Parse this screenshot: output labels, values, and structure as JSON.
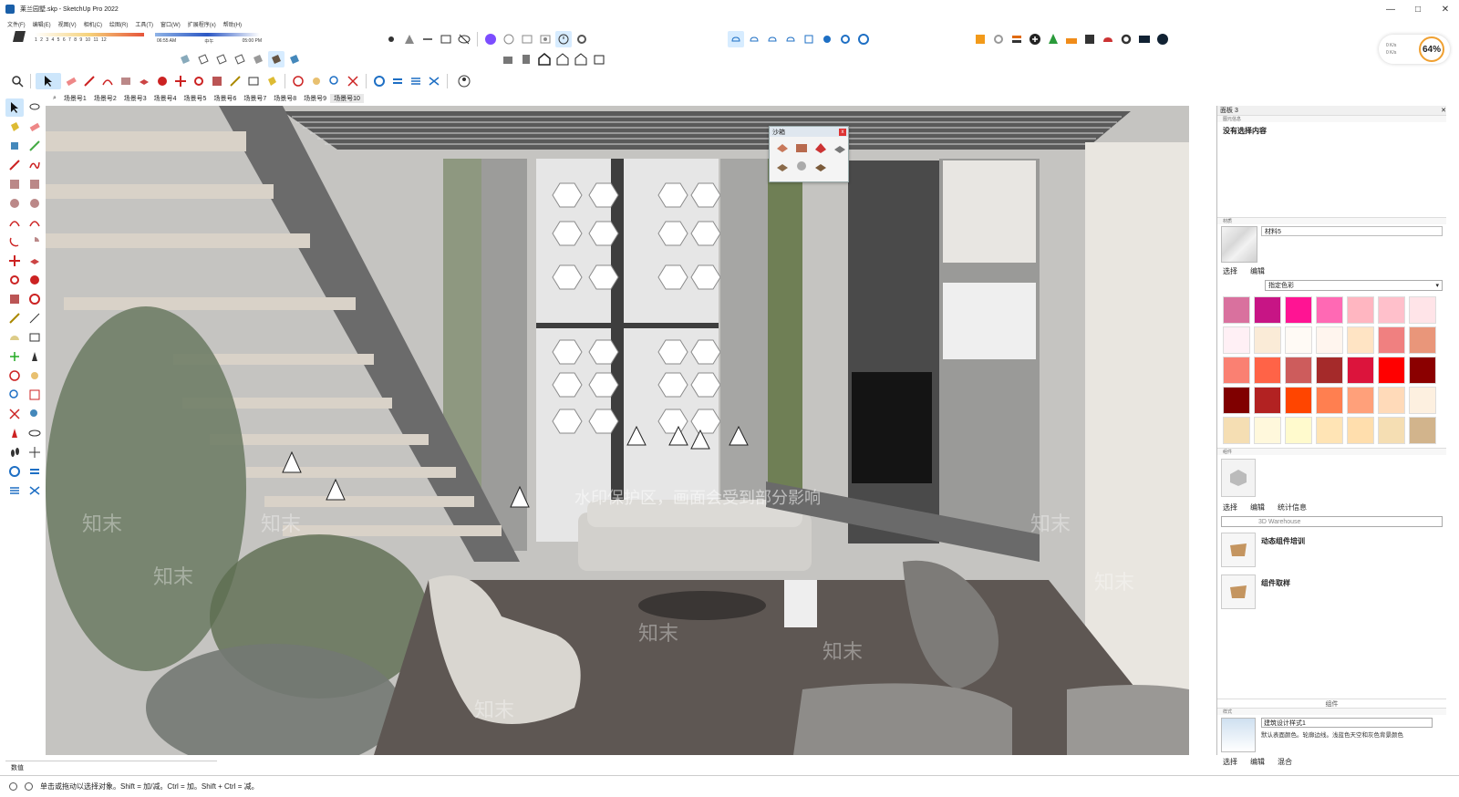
{
  "window": {
    "title": "莱兰园墅.skp - SketchUp Pro 2022",
    "minimize": "—",
    "maximize": "□",
    "close": "✕"
  },
  "menu": [
    "文件(F)",
    "编辑(E)",
    "视图(V)",
    "相机(C)",
    "绘图(R)",
    "工具(T)",
    "窗口(W)",
    "扩展程序(x)",
    "帮助(H)"
  ],
  "shadow": {
    "months": "1 2 3 4 5 6 7 8 9 10 11 12",
    "time_start": "06:55 AM",
    "time_mid": "中午",
    "time_end": "05:00 PM"
  },
  "scenes": [
    "场景号1",
    "场景号2",
    "场景号3",
    "场景号4",
    "场景号5",
    "场景号6",
    "场景号7",
    "场景号8",
    "场景号9",
    "场景号10"
  ],
  "active_scene_index": 9,
  "sandbox": {
    "title": "沙箱",
    "close": "x"
  },
  "watermark": {
    "text": "水印保护区，画面会受到部分影响",
    "brand": "知末"
  },
  "panel": {
    "title": "面板 3",
    "entity_info_header": "图元信息",
    "entity_info_text": "没有选择内容",
    "materials_header": "材质",
    "material_name": "材料5",
    "mat_tab_select": "选择",
    "mat_tab_edit": "编辑",
    "color_collection": "指定色彩",
    "swatches": [
      "#d9719e",
      "#c71585",
      "#ff1493",
      "#ff69b4",
      "#ffb6c1",
      "#ffc0cb",
      "#ffe4e8",
      "#fff0f5",
      "#faebd7",
      "#fffaf5",
      "#fff5ee",
      "#ffe4c4",
      "#f08080",
      "#e9967a",
      "#fa8072",
      "#ff6347",
      "#cd5c5c",
      "#a52a2a",
      "#dc143c",
      "#ff0000",
      "#8b0000",
      "#800000",
      "#b22222",
      "#ff4500",
      "#ff7f50",
      "#ffa07a",
      "#ffdab9",
      "#fdf0e0",
      "#f5deb3",
      "#fff8dc",
      "#fffacd",
      "#ffe4b5",
      "#ffdead",
      "#f5deb3",
      "#d2b48c"
    ],
    "components_header": "组件",
    "comp_tab_select": "选择",
    "comp_tab_edit": "编辑",
    "comp_tab_stats": "统计信息",
    "comp_search_placeholder": "3D Warehouse",
    "comp_items": [
      "动态组件培训",
      "组件取样"
    ],
    "comp_footer": "组件",
    "styles_header": "样式",
    "style_name": "建筑设计样式1",
    "style_desc": "默认表面颜色。轮廓边线。浅蓝色天空和灰色背景颜色",
    "style_tab_select": "选择",
    "style_tab_edit": "编辑",
    "style_tab_mix": "混合"
  },
  "measurements_label": "数值",
  "status_text": "单击或拖动以选择对象。Shift = 加/减。Ctrl = 加。Shift + Ctrl = 减。",
  "network": {
    "up": "0 K/s",
    "down": "0 K/s",
    "percent": "64%"
  }
}
